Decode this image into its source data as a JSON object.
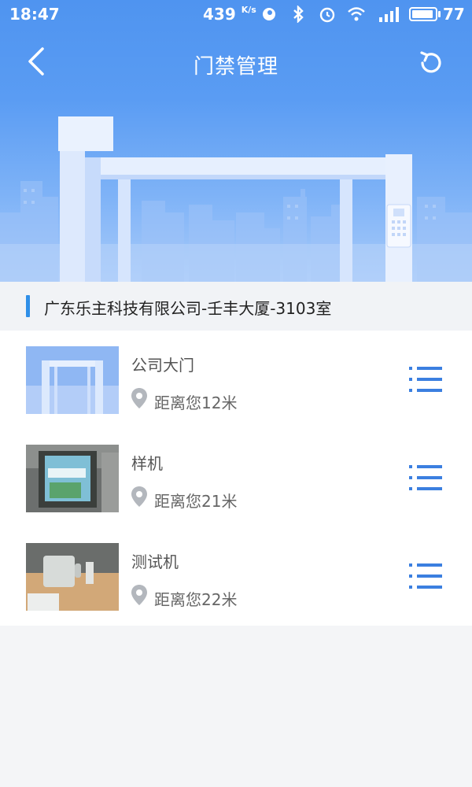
{
  "status_bar": {
    "time": "18:47",
    "net_speed": "439",
    "net_unit": "K/s",
    "battery": "77",
    "icons": [
      "notification-icon",
      "bluetooth-icon",
      "alarm-icon",
      "wifi-icon",
      "4g-signal-icon"
    ]
  },
  "nav": {
    "title": "门禁管理",
    "back_icon": "back-arrow-icon",
    "refresh_icon": "refresh-icon"
  },
  "address": {
    "text": "广东乐主科技有限公司-壬丰大厦-3103室"
  },
  "doors": [
    {
      "name": "公司大门",
      "distance": "距离您12米",
      "thumb": "gate-illustration"
    },
    {
      "name": "样机",
      "distance": "距离您21米",
      "thumb": "prototype-photo"
    },
    {
      "name": "测试机",
      "distance": "距离您22米",
      "thumb": "test-device-photo"
    }
  ],
  "colors": {
    "header_blue": "#4f94f0",
    "accent_blue": "#2f8fe8",
    "menu_icon_blue": "#3b7fe0"
  }
}
